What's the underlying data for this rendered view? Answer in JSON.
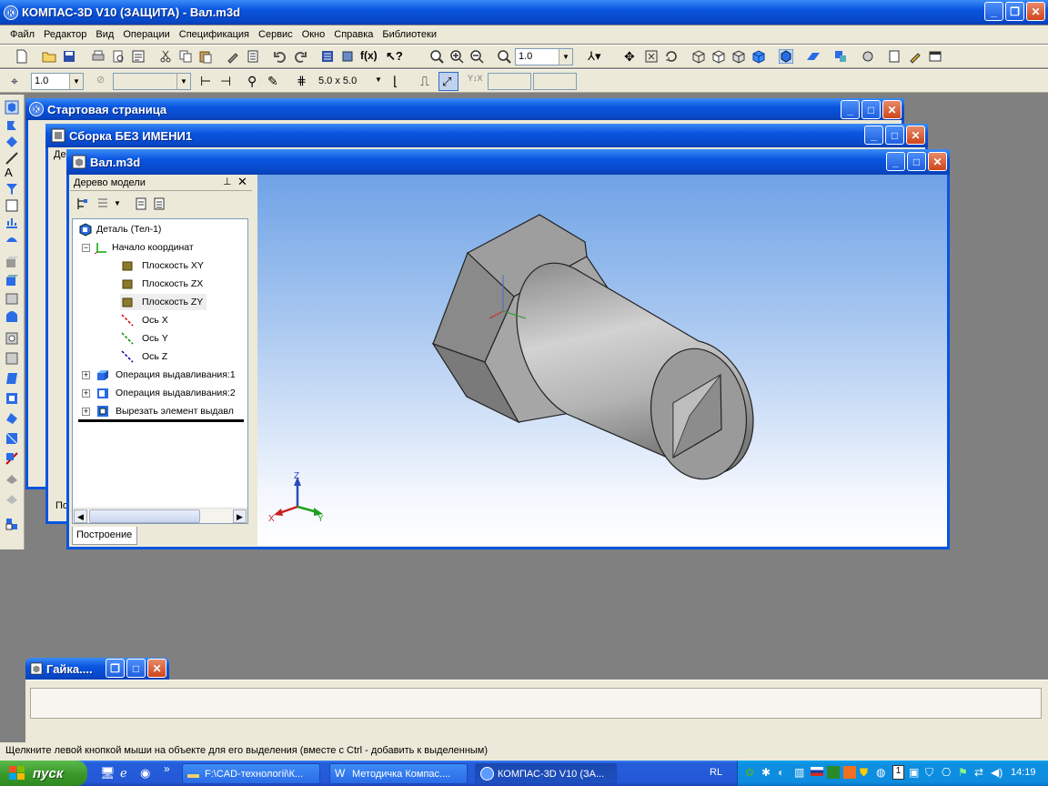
{
  "app": {
    "title": "КОМПАС-3D V10 (ЗАЩИТА) - Вал.m3d",
    "menu": [
      "Файл",
      "Редактор",
      "Вид",
      "Операции",
      "Спецификация",
      "Сервис",
      "Окно",
      "Справка",
      "Библиотеки"
    ]
  },
  "toolbar1": {
    "zoom_value": "1.0"
  },
  "toolbar2": {
    "step_value": "1.0",
    "grid_value": "5.0 x 5.0"
  },
  "windows": {
    "start_page": "Стартовая страница",
    "assembly": "Сборка БЕЗ ИМЕНИ1",
    "assembly_tab_stub": "Де",
    "assembly_bottom_tab_stub": "По",
    "shaft": "Вал.m3d",
    "nut_minimized": "Гайка...."
  },
  "tree": {
    "header": "Дерево модели",
    "bottom_tab": "Построение",
    "items": [
      {
        "label": "Деталь (Тел-1)"
      },
      {
        "label": "Начало координат"
      },
      {
        "label": "Плоскость XY"
      },
      {
        "label": "Плоскость ZX"
      },
      {
        "label": "Плоскость ZY"
      },
      {
        "label": "Ось X"
      },
      {
        "label": "Ось Y"
      },
      {
        "label": "Ось Z"
      },
      {
        "label": "Операция выдавливания:1"
      },
      {
        "label": "Операция выдавливания:2"
      },
      {
        "label": "Вырезать элемент выдавл"
      }
    ]
  },
  "axes": {
    "x": "X",
    "y": "Y",
    "z": "Z"
  },
  "status": {
    "hint": "Щелкните левой кнопкой мыши на объекте для его выделения (вместе с Ctrl - добавить к выделенным)"
  },
  "taskbar": {
    "start": "пуск",
    "buttons": [
      "F:\\CAD-технологіі\\К...",
      "Методичка Компас....",
      "КОМПАС-3D V10 (ЗА..."
    ],
    "lang": "RL",
    "clock": "14:19",
    "tray_num": "1"
  },
  "colors": {
    "xp_blue": "#0a55e0",
    "viewport_top": "#6fa2e6",
    "viewport_bottom": "#ffffff"
  }
}
